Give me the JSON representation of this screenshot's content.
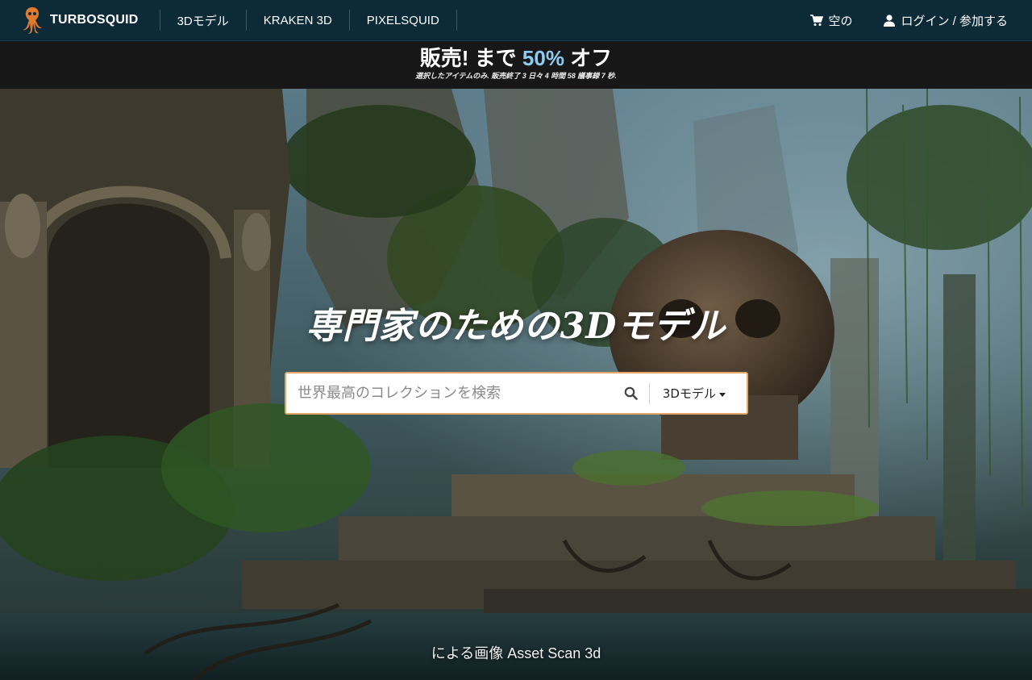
{
  "nav": {
    "logo_text": "TURBOSQUID",
    "items": [
      {
        "label": "3Dモデル"
      },
      {
        "label": "KRAKEN 3D"
      },
      {
        "label": "PIXELSQUID"
      }
    ],
    "cart_label": "空の",
    "login_label": "ログイン / 参加する"
  },
  "sale": {
    "title_prefix": "販売! まで ",
    "percent": "50%",
    "title_suffix": " オフ",
    "subtitle": "選択したアイテムのみ. 販売終了 3 日々 4 時間 58 議事録 7 秒."
  },
  "hero": {
    "title": "専門家のための3Dモデル",
    "search_placeholder": "世界最高のコレクションを検索",
    "search_type": "3Dモデル",
    "credit": "による画像 Asset Scan 3d"
  },
  "colors": {
    "nav_bg": "#0d2a38",
    "sale_bg": "#171717",
    "sale_accent": "#8ecbf0",
    "search_border": "#e5a66a",
    "logo_orange": "#e07b2e"
  },
  "icons": [
    "squid-logo-icon",
    "cart-icon",
    "user-icon",
    "search-icon",
    "chevron-down-icon"
  ]
}
